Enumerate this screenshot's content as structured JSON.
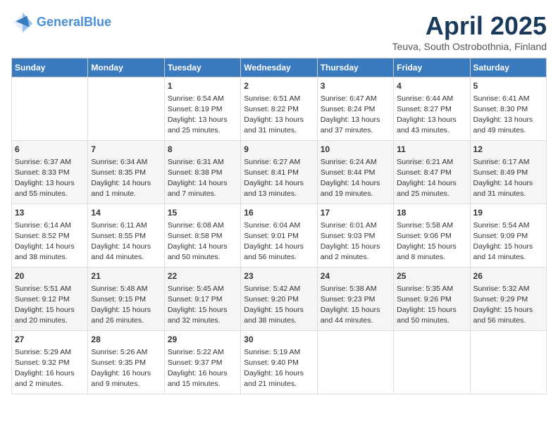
{
  "header": {
    "logo_line1": "General",
    "logo_line2": "Blue",
    "month": "April 2025",
    "location": "Teuva, South Ostrobothnia, Finland"
  },
  "weekdays": [
    "Sunday",
    "Monday",
    "Tuesday",
    "Wednesday",
    "Thursday",
    "Friday",
    "Saturday"
  ],
  "weeks": [
    [
      {
        "day": "",
        "info": ""
      },
      {
        "day": "",
        "info": ""
      },
      {
        "day": "1",
        "info": "Sunrise: 6:54 AM\nSunset: 8:19 PM\nDaylight: 13 hours\nand 25 minutes."
      },
      {
        "day": "2",
        "info": "Sunrise: 6:51 AM\nSunset: 8:22 PM\nDaylight: 13 hours\nand 31 minutes."
      },
      {
        "day": "3",
        "info": "Sunrise: 6:47 AM\nSunset: 8:24 PM\nDaylight: 13 hours\nand 37 minutes."
      },
      {
        "day": "4",
        "info": "Sunrise: 6:44 AM\nSunset: 8:27 PM\nDaylight: 13 hours\nand 43 minutes."
      },
      {
        "day": "5",
        "info": "Sunrise: 6:41 AM\nSunset: 8:30 PM\nDaylight: 13 hours\nand 49 minutes."
      }
    ],
    [
      {
        "day": "6",
        "info": "Sunrise: 6:37 AM\nSunset: 8:33 PM\nDaylight: 13 hours\nand 55 minutes."
      },
      {
        "day": "7",
        "info": "Sunrise: 6:34 AM\nSunset: 8:35 PM\nDaylight: 14 hours\nand 1 minute."
      },
      {
        "day": "8",
        "info": "Sunrise: 6:31 AM\nSunset: 8:38 PM\nDaylight: 14 hours\nand 7 minutes."
      },
      {
        "day": "9",
        "info": "Sunrise: 6:27 AM\nSunset: 8:41 PM\nDaylight: 14 hours\nand 13 minutes."
      },
      {
        "day": "10",
        "info": "Sunrise: 6:24 AM\nSunset: 8:44 PM\nDaylight: 14 hours\nand 19 minutes."
      },
      {
        "day": "11",
        "info": "Sunrise: 6:21 AM\nSunset: 8:47 PM\nDaylight: 14 hours\nand 25 minutes."
      },
      {
        "day": "12",
        "info": "Sunrise: 6:17 AM\nSunset: 8:49 PM\nDaylight: 14 hours\nand 31 minutes."
      }
    ],
    [
      {
        "day": "13",
        "info": "Sunrise: 6:14 AM\nSunset: 8:52 PM\nDaylight: 14 hours\nand 38 minutes."
      },
      {
        "day": "14",
        "info": "Sunrise: 6:11 AM\nSunset: 8:55 PM\nDaylight: 14 hours\nand 44 minutes."
      },
      {
        "day": "15",
        "info": "Sunrise: 6:08 AM\nSunset: 8:58 PM\nDaylight: 14 hours\nand 50 minutes."
      },
      {
        "day": "16",
        "info": "Sunrise: 6:04 AM\nSunset: 9:01 PM\nDaylight: 14 hours\nand 56 minutes."
      },
      {
        "day": "17",
        "info": "Sunrise: 6:01 AM\nSunset: 9:03 PM\nDaylight: 15 hours\nand 2 minutes."
      },
      {
        "day": "18",
        "info": "Sunrise: 5:58 AM\nSunset: 9:06 PM\nDaylight: 15 hours\nand 8 minutes."
      },
      {
        "day": "19",
        "info": "Sunrise: 5:54 AM\nSunset: 9:09 PM\nDaylight: 15 hours\nand 14 minutes."
      }
    ],
    [
      {
        "day": "20",
        "info": "Sunrise: 5:51 AM\nSunset: 9:12 PM\nDaylight: 15 hours\nand 20 minutes."
      },
      {
        "day": "21",
        "info": "Sunrise: 5:48 AM\nSunset: 9:15 PM\nDaylight: 15 hours\nand 26 minutes."
      },
      {
        "day": "22",
        "info": "Sunrise: 5:45 AM\nSunset: 9:17 PM\nDaylight: 15 hours\nand 32 minutes."
      },
      {
        "day": "23",
        "info": "Sunrise: 5:42 AM\nSunset: 9:20 PM\nDaylight: 15 hours\nand 38 minutes."
      },
      {
        "day": "24",
        "info": "Sunrise: 5:38 AM\nSunset: 9:23 PM\nDaylight: 15 hours\nand 44 minutes."
      },
      {
        "day": "25",
        "info": "Sunrise: 5:35 AM\nSunset: 9:26 PM\nDaylight: 15 hours\nand 50 minutes."
      },
      {
        "day": "26",
        "info": "Sunrise: 5:32 AM\nSunset: 9:29 PM\nDaylight: 15 hours\nand 56 minutes."
      }
    ],
    [
      {
        "day": "27",
        "info": "Sunrise: 5:29 AM\nSunset: 9:32 PM\nDaylight: 16 hours\nand 2 minutes."
      },
      {
        "day": "28",
        "info": "Sunrise: 5:26 AM\nSunset: 9:35 PM\nDaylight: 16 hours\nand 9 minutes."
      },
      {
        "day": "29",
        "info": "Sunrise: 5:22 AM\nSunset: 9:37 PM\nDaylight: 16 hours\nand 15 minutes."
      },
      {
        "day": "30",
        "info": "Sunrise: 5:19 AM\nSunset: 9:40 PM\nDaylight: 16 hours\nand 21 minutes."
      },
      {
        "day": "",
        "info": ""
      },
      {
        "day": "",
        "info": ""
      },
      {
        "day": "",
        "info": ""
      }
    ]
  ]
}
